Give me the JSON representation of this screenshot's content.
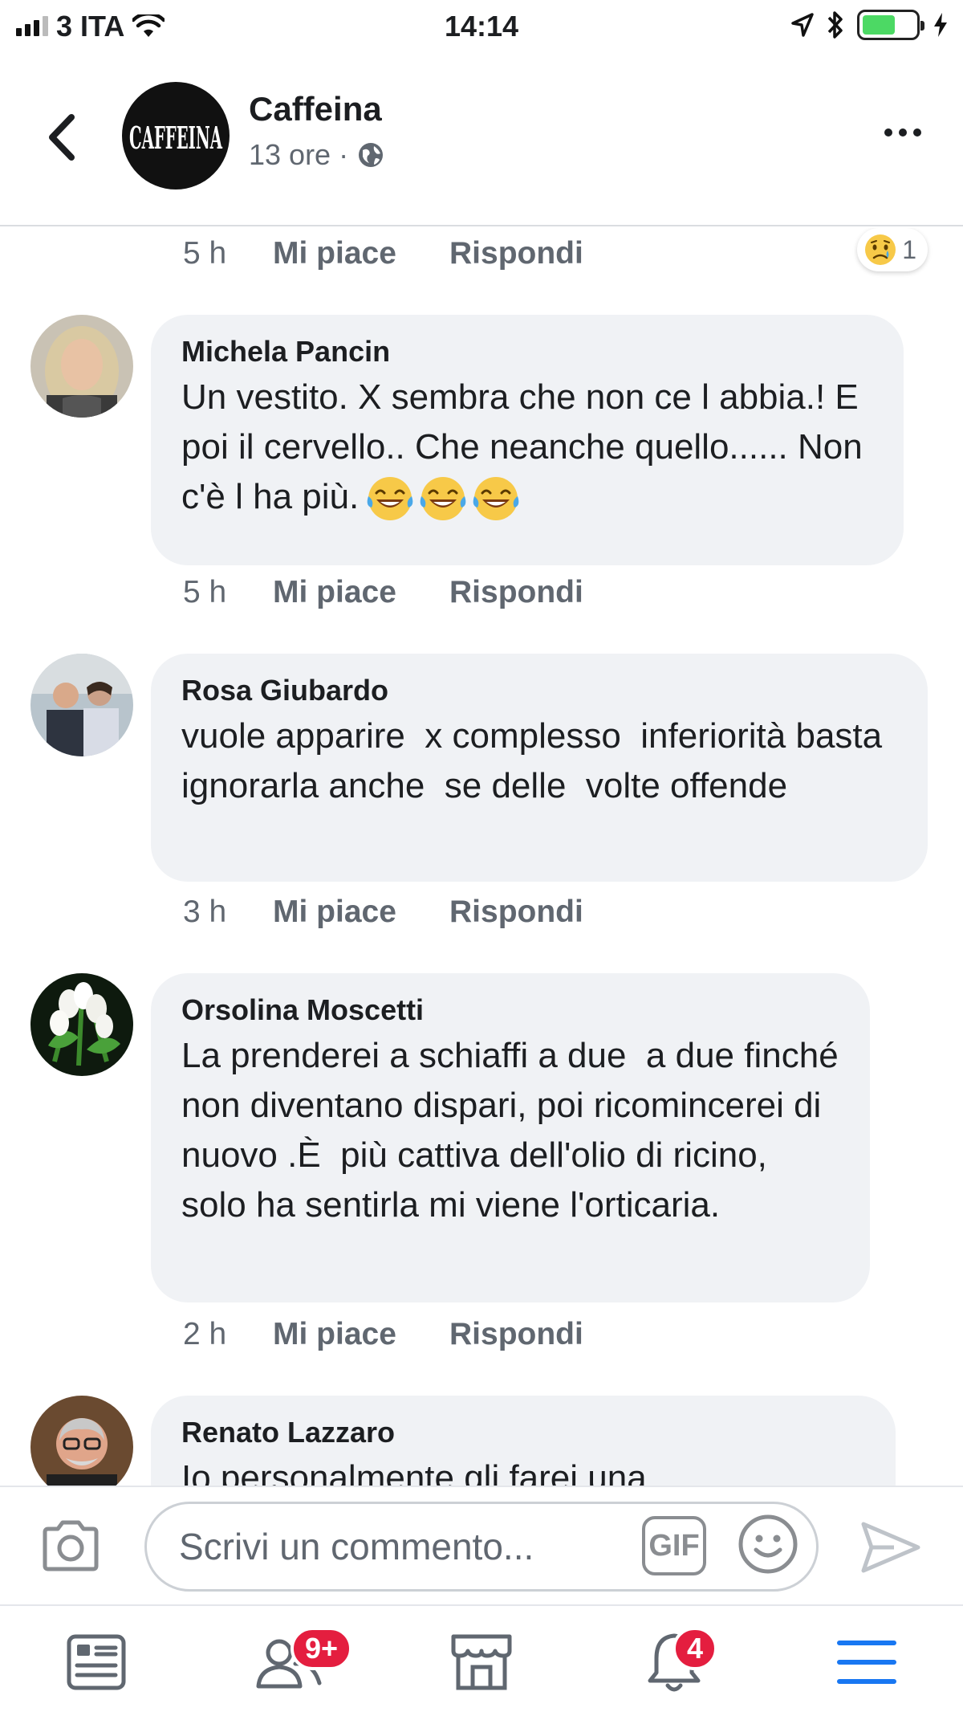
{
  "status_bar": {
    "carrier": "3 ITA",
    "time": "14:14"
  },
  "header": {
    "page_name": "Caffeina",
    "post_age": "13 ore",
    "separator": "·",
    "avatar_logo_text": "CAFFEINA"
  },
  "colors": {
    "bubble_bg": "#f0f2f5",
    "meta_gray": "#606770",
    "badge_red": "#e41e3f",
    "menu_blue": "#1877f2"
  },
  "top_action_row": {
    "time": "5 h",
    "like": "Mi piace",
    "reply": "Rispondi",
    "reaction_icon": "sad-face-icon",
    "reaction_count": "1"
  },
  "comments": [
    {
      "author": "Michela Pancin",
      "text": "Un vestito. X sembra che non ce l abbia.! E poi il cervello.. Che neanche quello...... Non c'è l ha più.",
      "emojis": [
        "laughing-tears-icon",
        "laughing-tears-icon",
        "laughing-tears-icon"
      ],
      "time": "5 h",
      "like": "Mi piace",
      "reply": "Rispondi"
    },
    {
      "author": "Rosa Giubardo",
      "text": "vuole apparire  x complesso  inferiorità basta  ignorarla anche  se delle  volte offende",
      "time": "3 h",
      "like": "Mi piace",
      "reply": "Rispondi"
    },
    {
      "author": "Orsolina Moscetti",
      "text": "La prenderei a schiaffi a due  a due finché non diventano dispari, poi ricomincerei di nuovo .È  più cattiva dell'olio di ricino, solo ha sentirla mi viene l'orticaria.",
      "time": "2 h",
      "like": "Mi piace",
      "reply": "Rispondi"
    },
    {
      "author": "Renato Lazzaro",
      "text": "Io personalmente gli farei una"
    }
  ],
  "composer": {
    "placeholder": "Scrivi un commento...",
    "gif_label": "GIF"
  },
  "bottom_nav": {
    "friends_badge": "9+",
    "notifications_badge": "4"
  }
}
